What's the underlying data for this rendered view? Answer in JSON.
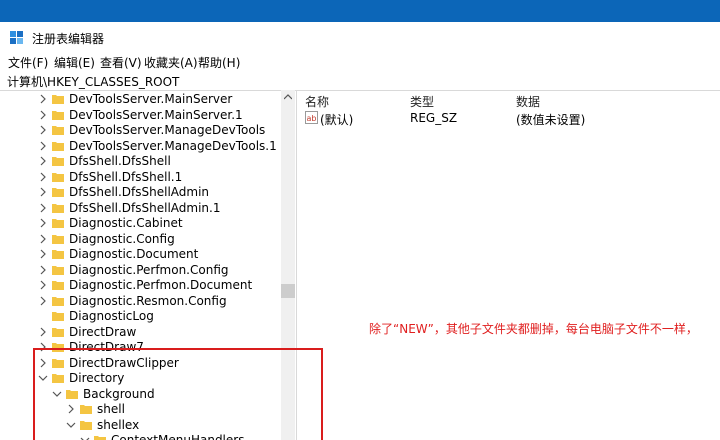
{
  "window": {
    "title": "注册表编辑器"
  },
  "menu": [
    "文件(F)",
    "编辑(E)",
    "查看(V)",
    "收藏夹(A)",
    "帮助(H)"
  ],
  "address": "计算机\\HKEY_CLASSES_ROOT",
  "tree": [
    {
      "label": "DevToolsServer.MainServer",
      "expanded": false,
      "has_children": true
    },
    {
      "label": "DevToolsServer.MainServer.1",
      "expanded": false,
      "has_children": true
    },
    {
      "label": "DevToolsServer.ManageDevTools",
      "expanded": false,
      "has_children": true
    },
    {
      "label": "DevToolsServer.ManageDevTools.1",
      "expanded": false,
      "has_children": true
    },
    {
      "label": "DfsShell.DfsShell",
      "expanded": false,
      "has_children": true
    },
    {
      "label": "DfsShell.DfsShell.1",
      "expanded": false,
      "has_children": true
    },
    {
      "label": "DfsShell.DfsShellAdmin",
      "expanded": false,
      "has_children": true
    },
    {
      "label": "DfsShell.DfsShellAdmin.1",
      "expanded": false,
      "has_children": true
    },
    {
      "label": "Diagnostic.Cabinet",
      "expanded": false,
      "has_children": true
    },
    {
      "label": "Diagnostic.Config",
      "expanded": false,
      "has_children": true
    },
    {
      "label": "Diagnostic.Document",
      "expanded": false,
      "has_children": true
    },
    {
      "label": "Diagnostic.Perfmon.Config",
      "expanded": false,
      "has_children": true
    },
    {
      "label": "Diagnostic.Perfmon.Document",
      "expanded": false,
      "has_children": true
    },
    {
      "label": "Diagnostic.Resmon.Config",
      "expanded": false,
      "has_children": true
    },
    {
      "label": "DiagnosticLog",
      "expanded": false,
      "has_children": false
    },
    {
      "label": "DirectDraw",
      "expanded": false,
      "has_children": true
    },
    {
      "label": "DirectDraw7",
      "expanded": false,
      "has_children": true
    },
    {
      "label": "DirectDrawClipper",
      "expanded": false,
      "has_children": true
    },
    {
      "label": "Directory",
      "expanded": true,
      "has_children": true
    },
    {
      "label": "Background",
      "expanded": true,
      "has_children": true
    },
    {
      "label": "shell",
      "expanded": false,
      "has_children": true
    },
    {
      "label": "shellex",
      "expanded": true,
      "has_children": true
    },
    {
      "label": "ContextMenuHandlers",
      "expanded": true,
      "has_children": true
    }
  ],
  "columns": {
    "name": "名称",
    "type": "类型",
    "data": "数据"
  },
  "values": [
    {
      "name": "(默认)",
      "type": "REG_SZ",
      "data": "(数值未设置)"
    }
  ],
  "annotation": "除了“NEW”，其他子文件夹都删掉，每台电脑子文件不一样，",
  "colors": {
    "folder": "#f4c542",
    "annotation": "#e01f1f",
    "desktop": "#0c66b8"
  }
}
